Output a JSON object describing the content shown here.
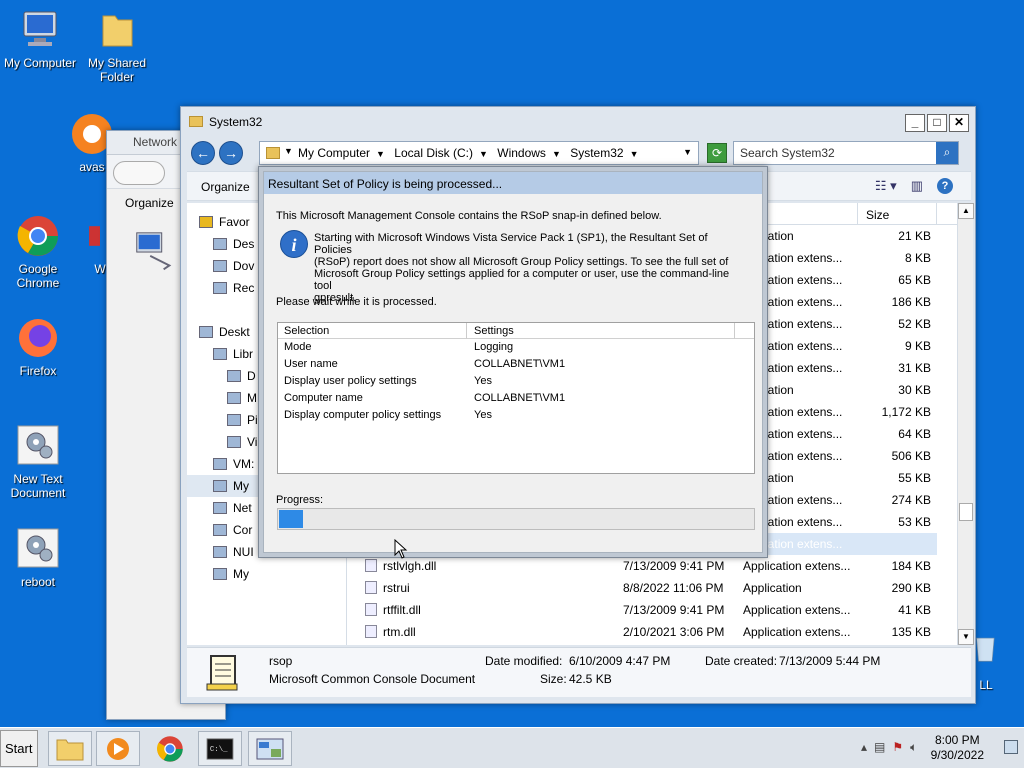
{
  "desktop": {
    "icons": [
      {
        "label": "My Computer"
      },
      {
        "label": "My Shared Folder"
      },
      {
        "label": "avas"
      },
      {
        "label": "Google Chrome"
      },
      {
        "label": "W"
      },
      {
        "label": "Firefox"
      },
      {
        "label": "New Text Document"
      },
      {
        "label": "reboot"
      },
      {
        "label": "LL"
      }
    ]
  },
  "bg_window": {
    "title": "Network",
    "organize_label": "Organize"
  },
  "explorer": {
    "title": "System32",
    "breadcrumb": [
      "My Computer",
      "Local Disk (C:)",
      "Windows",
      "System32"
    ],
    "search_placeholder": "Search System32",
    "organize_label": "Organize",
    "size_header": "Size",
    "nav_items": [
      {
        "label": "Favor",
        "indent": 0
      },
      {
        "label": "Des",
        "indent": 1
      },
      {
        "label": "Dov",
        "indent": 1
      },
      {
        "label": "Rec",
        "indent": 1
      },
      {
        "label": "",
        "indent": 0
      },
      {
        "label": "Deskt",
        "indent": 0
      },
      {
        "label": "Libr",
        "indent": 1
      },
      {
        "label": "D",
        "indent": 2
      },
      {
        "label": "M",
        "indent": 2
      },
      {
        "label": "Pi",
        "indent": 2
      },
      {
        "label": "Vi",
        "indent": 2
      },
      {
        "label": "VM:",
        "indent": 1
      },
      {
        "label": "My",
        "indent": 1
      },
      {
        "label": "Net",
        "indent": 1
      },
      {
        "label": "Cor",
        "indent": 1
      },
      {
        "label": "NUI",
        "indent": 1
      },
      {
        "label": "My",
        "indent": 1
      }
    ],
    "files_partial": [
      {
        "type": "pplication",
        "size": "21 KB"
      },
      {
        "type": "pplication extens...",
        "size": "8 KB"
      },
      {
        "type": "pplication extens...",
        "size": "65 KB"
      },
      {
        "type": "pplication extens...",
        "size": "186 KB"
      },
      {
        "type": "pplication extens...",
        "size": "52 KB"
      },
      {
        "type": "pplication extens...",
        "size": "9 KB"
      },
      {
        "type": "pplication extens...",
        "size": "31 KB"
      },
      {
        "type": "pplication",
        "size": "30 KB"
      },
      {
        "type": "pplication extens...",
        "size": "1,172 KB"
      },
      {
        "type": "pplication extens...",
        "size": "64 KB"
      },
      {
        "type": "pplication extens...",
        "size": "506 KB"
      },
      {
        "type": "pplication",
        "size": "55 KB"
      },
      {
        "type": "pplication extens...",
        "size": "274 KB"
      },
      {
        "type": "pplication extens...",
        "size": "53 KB"
      },
      {
        "type": "pplication extens...",
        "size": ""
      }
    ],
    "files_full": [
      {
        "name": "rstlvlgh.dll",
        "date": "7/13/2009 9:41 PM",
        "type": "Application extens...",
        "size": "184 KB"
      },
      {
        "name": "rstrui",
        "date": "8/8/2022 11:06 PM",
        "type": "Application",
        "size": "290 KB"
      },
      {
        "name": "rtffilt.dll",
        "date": "7/13/2009 9:41 PM",
        "type": "Application extens...",
        "size": "41 KB"
      },
      {
        "name": "rtm.dll",
        "date": "2/10/2021 3:06 PM",
        "type": "Application extens...",
        "size": "135 KB"
      }
    ],
    "details": {
      "name": "rsop",
      "type": "Microsoft Common Console Document",
      "modified_label": "Date modified:",
      "modified": "6/10/2009 4:47 PM",
      "created_label": "Date created:",
      "created": "7/13/2009 5:44 PM",
      "size_label": "Size:",
      "size": "42.5 KB"
    }
  },
  "rsop_dialog": {
    "title": "Resultant Set of Policy is being processed...",
    "intro": "This Microsoft Management Console contains the RSoP snap-in defined below.",
    "info_lines": [
      "Starting with Microsoft Windows Vista Service Pack 1 (SP1), the Resultant Set of Policies",
      "(RSoP) report does not show all Microsoft Group Policy settings.  To see the full set of",
      "Microsoft Group Policy settings applied for a computer or user, use the command-line tool",
      "gpresult."
    ],
    "wait": "Please wait while it is processed.",
    "col_selection": "Selection",
    "col_settings": "Settings",
    "rows": [
      {
        "selection": "Mode",
        "setting": "Logging"
      },
      {
        "selection": "User name",
        "setting": "COLLABNET\\VM1"
      },
      {
        "selection": "Display user policy settings",
        "setting": "Yes"
      },
      {
        "selection": "Computer name",
        "setting": "COLLABNET\\VM1"
      },
      {
        "selection": "Display computer policy settings",
        "setting": "Yes"
      }
    ],
    "progress_label": "Progress:",
    "progress_fraction": 0.05
  },
  "taskbar": {
    "start_label": "Start",
    "time": "8:00 PM",
    "date": "9/30/2022"
  },
  "colors": {
    "desktop": "#0a6fd6",
    "progress": "#2e8ae6"
  }
}
